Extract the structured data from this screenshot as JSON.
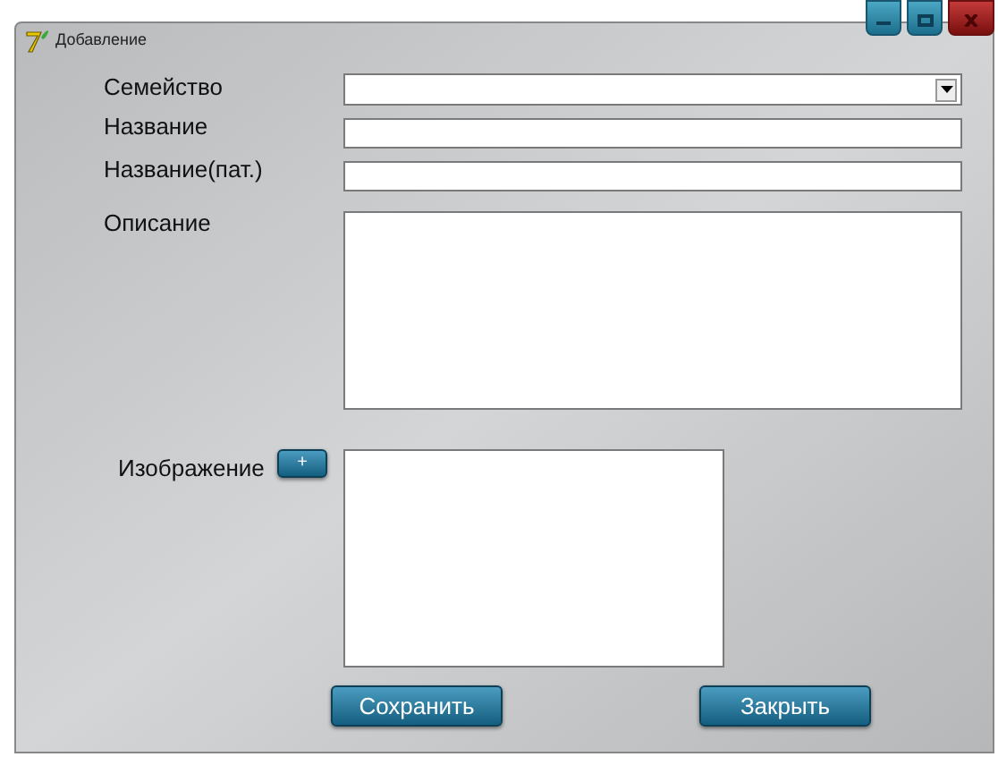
{
  "window": {
    "title": "Добавление"
  },
  "fields": [
    {
      "label": "Семейство",
      "kind": "combo"
    },
    {
      "label": "Название",
      "kind": "text"
    },
    {
      "label": "Название(пат.)",
      "kind": "text"
    },
    {
      "label": "Описание",
      "kind": "memo"
    }
  ],
  "image": {
    "label": "Изображение",
    "add_button": "+"
  },
  "buttons": [
    "Сохранить",
    "Закрыть"
  ]
}
